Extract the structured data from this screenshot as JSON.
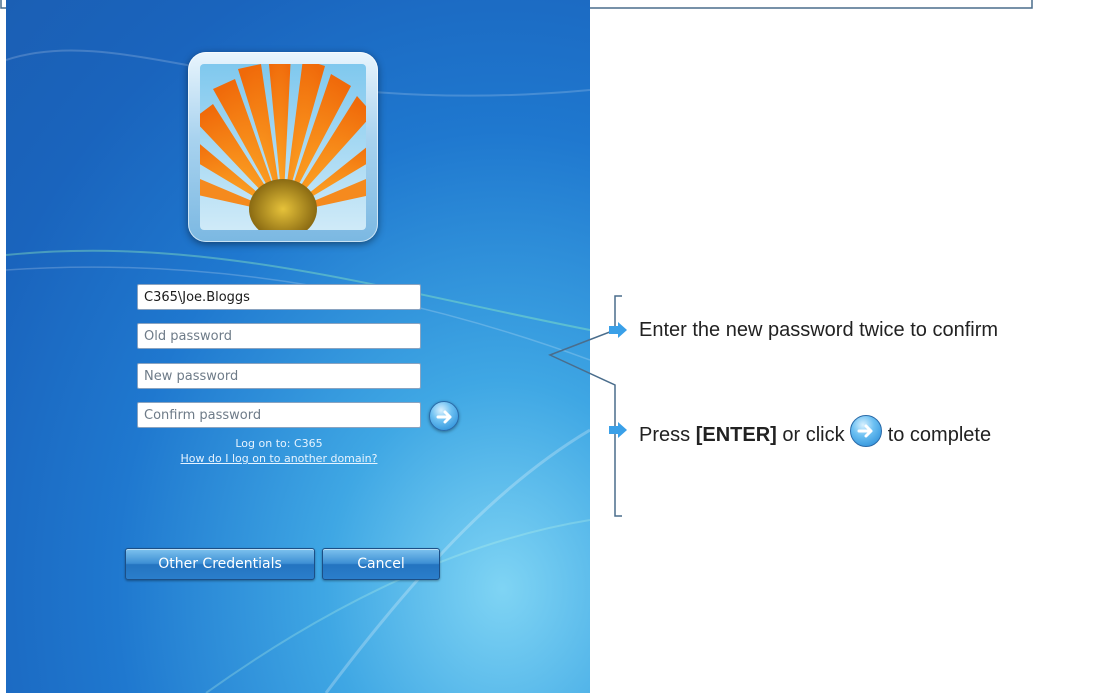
{
  "logon": {
    "username_value": "C365\\Joe.Bloggs",
    "old_password_placeholder": "Old password",
    "new_password_placeholder": "New password",
    "confirm_password_placeholder": "Confirm password",
    "logon_to": "Log on to: C365",
    "domain_link": "How do I log on to another domain?",
    "other_credentials_label": "Other Credentials",
    "cancel_label": "Cancel"
  },
  "instructions": {
    "line1": "Enter the new password twice to confirm",
    "line2_prefix": "Press ",
    "line2_key": "[ENTER]",
    "line2_mid": " or click ",
    "line2_suffix": " to complete"
  },
  "icons": {
    "go": "arrow-right-circle-icon",
    "bullet": "blue-arrow-bullet-icon",
    "avatar": "orange-flower-avatar"
  },
  "colors": {
    "screen_blue": "#1f78cf",
    "accent_orange": "#f28a1a",
    "callout_border": "#4a6d8c"
  }
}
